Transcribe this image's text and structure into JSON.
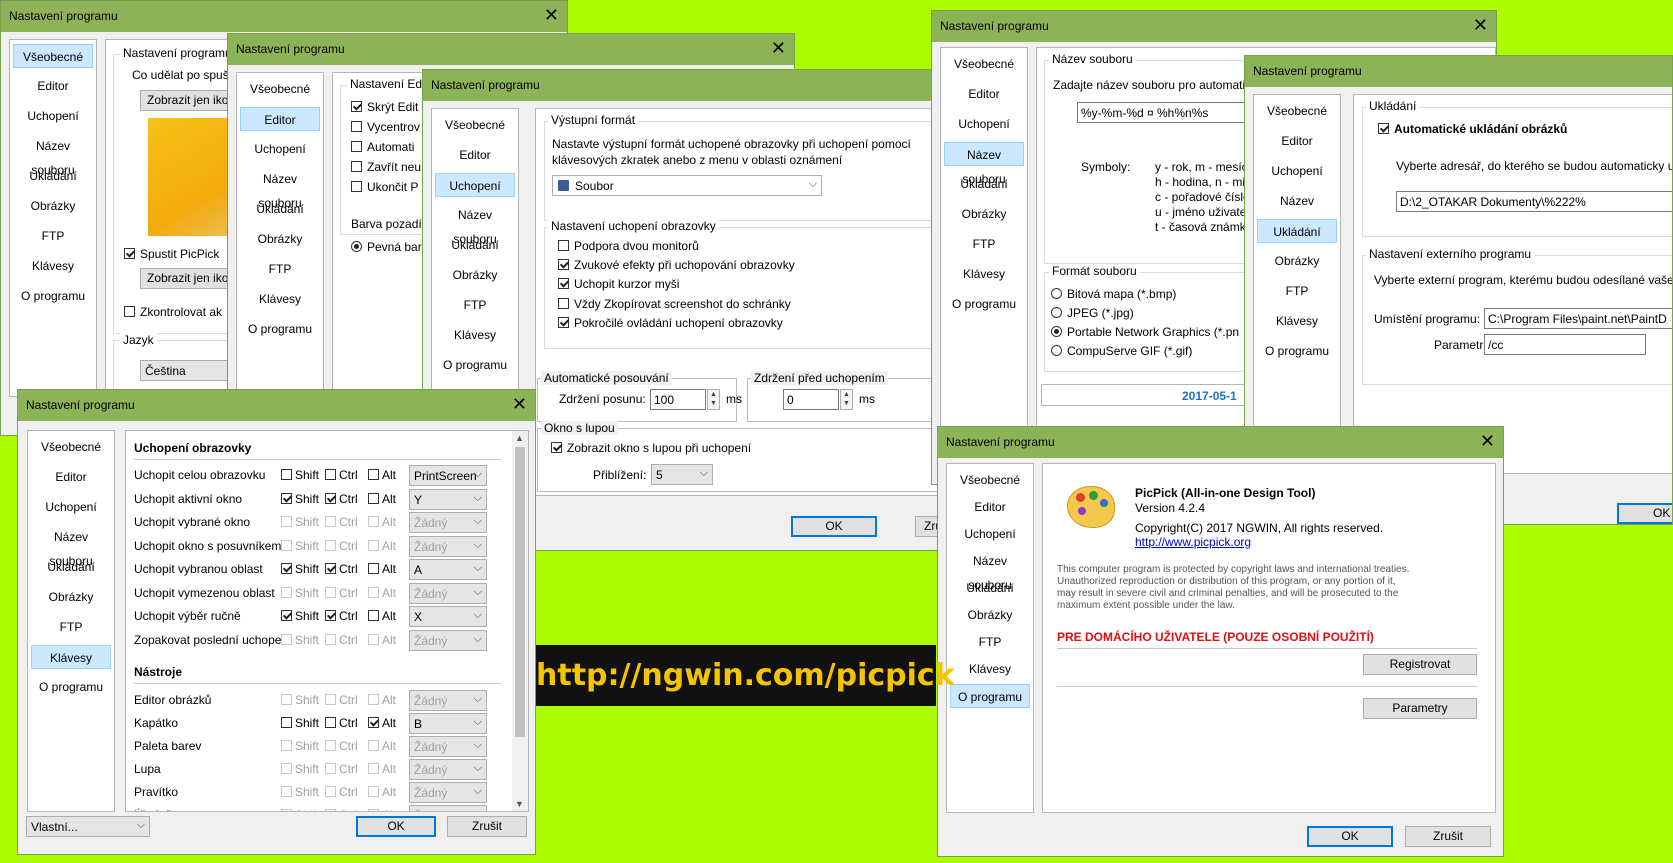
{
  "common": {
    "title": "Nastavení programu",
    "close": "✕",
    "nav": [
      "Všeobecné",
      "Editor",
      "Uchopení",
      "Název souboru",
      "Ukládání",
      "Obrázky",
      "FTP",
      "Klávesy",
      "O programu"
    ],
    "ok": "OK",
    "cancel": "Zrušit"
  },
  "w1": {
    "group_program": "Nastavení programu",
    "question": "Co udělat po spušt",
    "btn_icon": "Zobrazit jen iko",
    "run_picpick": "Spustit PicPick",
    "btn_icon2": "Zobrazit jen iko",
    "check_updates": "Zkontrolovat ak",
    "group_lang": "Jazyk",
    "lang_value": "Čeština"
  },
  "w2": {
    "group_editor": "Nastavení Edi",
    "opts": [
      "Skrýt Edit",
      "Vycentrov",
      "Automati",
      "Zavřít neu",
      "Ukončit P"
    ],
    "bg_label": "Barva pozadí",
    "bg_solid": "Pevná bar"
  },
  "w3": {
    "group_output": "Výstupní formát",
    "output_desc1": "Nastavte výstupní formát uchopené obrazovky při uchopení pomocí",
    "output_desc2": "klávesových zkratek anebo z menu v oblasti oznámení",
    "output_value": "Soubor",
    "group_capture": "Nastavení uchopení obrazovky",
    "capture_opts": [
      "Podpora dvou monitorů",
      "Zvukové efekty při uchopování obrazovky",
      "Uchopit kurzor myši",
      "Vždy Zkopírovat screenshot do schránky",
      "Pokročilé ovládání uchopení obrazovky"
    ],
    "group_autoscroll": "Automatické posouvání",
    "scroll_delay_label": "Zdržení posunu:",
    "scroll_delay": "100",
    "group_delay": "Zdržení před uchopením",
    "delay_value": "0",
    "ms": "ms",
    "group_magnifier": "Okno s lupou",
    "show_magnifier": "Zobrazit okno s lupou při uchopení",
    "zoom_label": "Přiblížení:",
    "zoom_value": "5",
    "cancel_partial": "Zru"
  },
  "w4": {
    "section_capture": "Uchopení obrazovky",
    "section_tools": "Nástroje",
    "shift": "Shift",
    "ctrl": "Ctrl",
    "alt": "Alt",
    "rows": [
      {
        "label": "Uchopit celou obrazovku",
        "key": "PrintScreen"
      },
      {
        "label": "Uchopit aktivní okno",
        "key": "Y"
      },
      {
        "label": "Uchopit vybrané okno",
        "key": "Žádný"
      },
      {
        "label": "Uchopit okno s posuvníkem",
        "key": "Žádný"
      },
      {
        "label": "Uchopit vybranou oblast",
        "key": "A"
      },
      {
        "label": "Uchopit vymezenou oblast",
        "key": "Žádný"
      },
      {
        "label": "Uchopit výběr ručně",
        "key": "X"
      },
      {
        "label": "Zopakovat poslední uchopení",
        "key": "Žádný"
      }
    ],
    "tool_rows": [
      {
        "label": "Editor obrázků",
        "key": "Žádný"
      },
      {
        "label": "Kapátko",
        "key": "B"
      },
      {
        "label": "Paleta barev",
        "key": "Žádný"
      },
      {
        "label": "Lupa",
        "key": "Žádný"
      },
      {
        "label": "Pravítko",
        "key": "Žádný"
      },
      {
        "label": "Úhelník",
        "key": "Žádný"
      }
    ],
    "preset": "Vlastní..."
  },
  "w5": {
    "group_filename": "Název souboru",
    "filename_desc": "Zadajte název souboru pro automati",
    "pattern": "%y-%m-%d ¤ %h%n%s",
    "symbols_label": "Symboly:",
    "symbols": [
      "y - rok, m - mesíc,",
      "h - hodina, n - mi",
      "c - pořadové číslo",
      "u - jméno uživatel",
      "t - časová známka"
    ],
    "group_format": "Formát souboru",
    "formats": [
      "Bitová mapa (*.bmp)",
      "JPEG (*.jpg)",
      "Portable Network Graphics (*.pn",
      "CompuServe GIF (*.gif)"
    ],
    "preview": "2017-05-1"
  },
  "w6": {
    "group_save": "Ukládání",
    "autosave": "Automatické ukládání obrázků",
    "dir_desc": "Vyberte adresář, do kterého se budou automaticky u",
    "dir_value": "D:\\2_OTAKAR Dokumenty\\%222%",
    "group_ext": "Nastavení externího programu",
    "ext_desc": "Vyberte externí program, kterému budou odesílané vaše",
    "location_label": "Umístění programu:",
    "location_value": "C:\\Program Files\\paint.net\\PaintD",
    "param_label": "Parametr:",
    "param_value": "/cc"
  },
  "w7": {
    "app_name": "PicPick (All-in-one Design Tool)",
    "version": "Version 4.2.4",
    "copyright": "Copyright(C) 2017 NGWIN, All rights reserved.",
    "url": "http://www.picpick.org",
    "legal": [
      "This computer program is protected by copyright laws and international treaties.",
      "Unauthorized reproduction or distribution of this program, or any portion of it,",
      "may result in severe civil and criminal penalties, and will be prosecuted to the",
      "maximum extent possible under the law."
    ],
    "home_use": "PRE DOMÁCÍHO UŽIVATELE (POUZE OSOBNÍ POUŽITÍ)",
    "register": "Registrovat",
    "params": "Parametry"
  },
  "banner": {
    "text": "http://ngwin.com/picpick"
  },
  "colors": {
    "background": "#acfc00",
    "titlebar": "#8db359",
    "banner_bg": "#111111",
    "banner_text": "#f5c400",
    "accent": "#0078d7",
    "home_use": "#e01010"
  }
}
